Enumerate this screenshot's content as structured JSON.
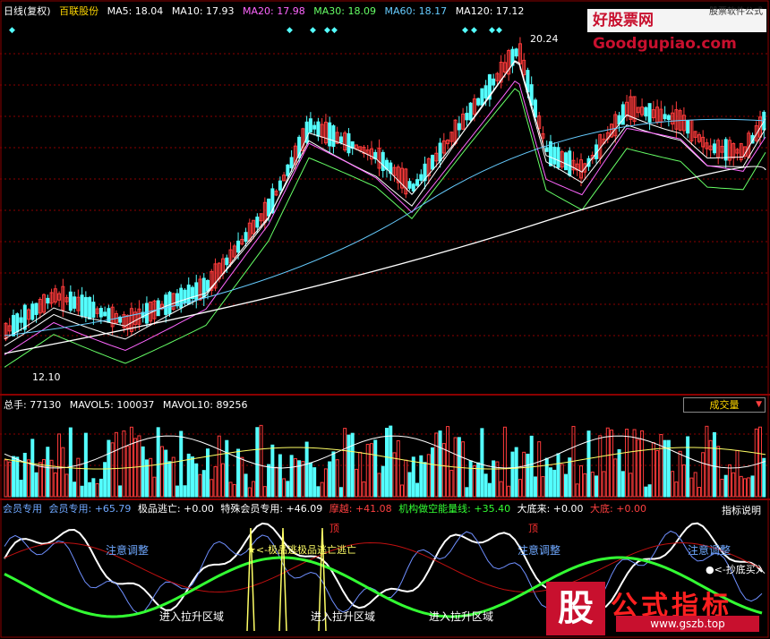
{
  "main_header": {
    "period": "日线(复权)",
    "stock": "百联股份",
    "ma": [
      {
        "label": "MA5: 18.04",
        "color": "#ffffff"
      },
      {
        "label": "MA10: 17.93",
        "color": "#ffffff"
      },
      {
        "label": "MA20: 17.98",
        "color": "#ff66ff"
      },
      {
        "label": "MA30: 18.09",
        "color": "#66ff66"
      },
      {
        "label": "MA60: 18.17",
        "color": "#66ccff"
      },
      {
        "label": "MA120: 17.12",
        "color": "#ffffff"
      }
    ]
  },
  "price_marks": {
    "high": "20.24",
    "low": "12.10"
  },
  "watermark_top": {
    "text": "好股票网Goodgupiao.com",
    "sub": "股票软件公式"
  },
  "volume_header": {
    "total": "总手: 77130",
    "mavol5": "MAVOL5: 100037",
    "mavol10": "MAVOL10: 89256",
    "selector": "成交量",
    "selector_icon": "triangle-down-icon"
  },
  "indicator_header": [
    {
      "text": "会员专用",
      "color": "#6fa8ff"
    },
    {
      "text": "会员专用: +65.79",
      "color": "#6fa8ff"
    },
    {
      "text": "极品逃亡: +0.00",
      "color": "#ffffff"
    },
    {
      "text": "特殊会员专用: +46.09",
      "color": "#ffffff"
    },
    {
      "text": "摩越: +41.08",
      "color": "#ff4040"
    },
    {
      "text": "机构做空能量线: +35.40",
      "color": "#33ff33"
    },
    {
      "text": "大底来: +0.00",
      "color": "#ffffff"
    },
    {
      "text": "大底: +0.00",
      "color": "#ff4040"
    }
  ],
  "indicator_button": "指标说明",
  "indicator_labels": {
    "top1": "顶",
    "top2": "顶",
    "adjust1": "注意调整",
    "adjust2": "注意调整",
    "adjust3": "注意调整",
    "escape": "★<-极品逃极品逃亡逃亡",
    "pull1": "进入拉升区域",
    "pull2": "进入拉升区域",
    "pull3": "进入拉升区域",
    "buy": "●<-抄底买入"
  },
  "logo_bottom": {
    "box": "股",
    "text": "公式指标",
    "url": "www.gszb.top"
  },
  "colors": {
    "up": "#ff3b3b",
    "down": "#54ffff",
    "grid": "#8b0000",
    "green": "#33ff33"
  }
}
